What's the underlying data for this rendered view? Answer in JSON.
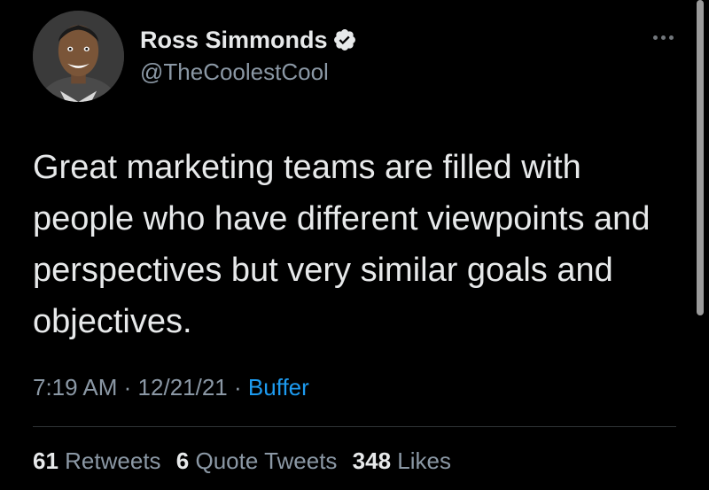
{
  "author": {
    "display_name": "Ross Simmonds",
    "handle": "@TheCoolestCool",
    "verified": true,
    "avatar_icon": "profile-photo"
  },
  "tweet": {
    "text": "Great marketing teams are filled with people who have different viewpoints and perspectives but very similar goals and objectives.",
    "time": "7:19 AM",
    "separator": "·",
    "date": "12/21/21",
    "source": "Buffer"
  },
  "stats": {
    "retweets_count": "61",
    "retweets_label": "Retweets",
    "quotes_count": "6",
    "quotes_label": "Quote Tweets",
    "likes_count": "348",
    "likes_label": "Likes"
  },
  "colors": {
    "background": "#000000",
    "primary_text": "#e7e9ea",
    "secondary_text": "#8b98a5",
    "link": "#1d9bf0",
    "verified_badge": "#e7e9ea"
  },
  "icons": {
    "more": "more-horizontal-icon",
    "verified": "verified-badge-icon"
  }
}
